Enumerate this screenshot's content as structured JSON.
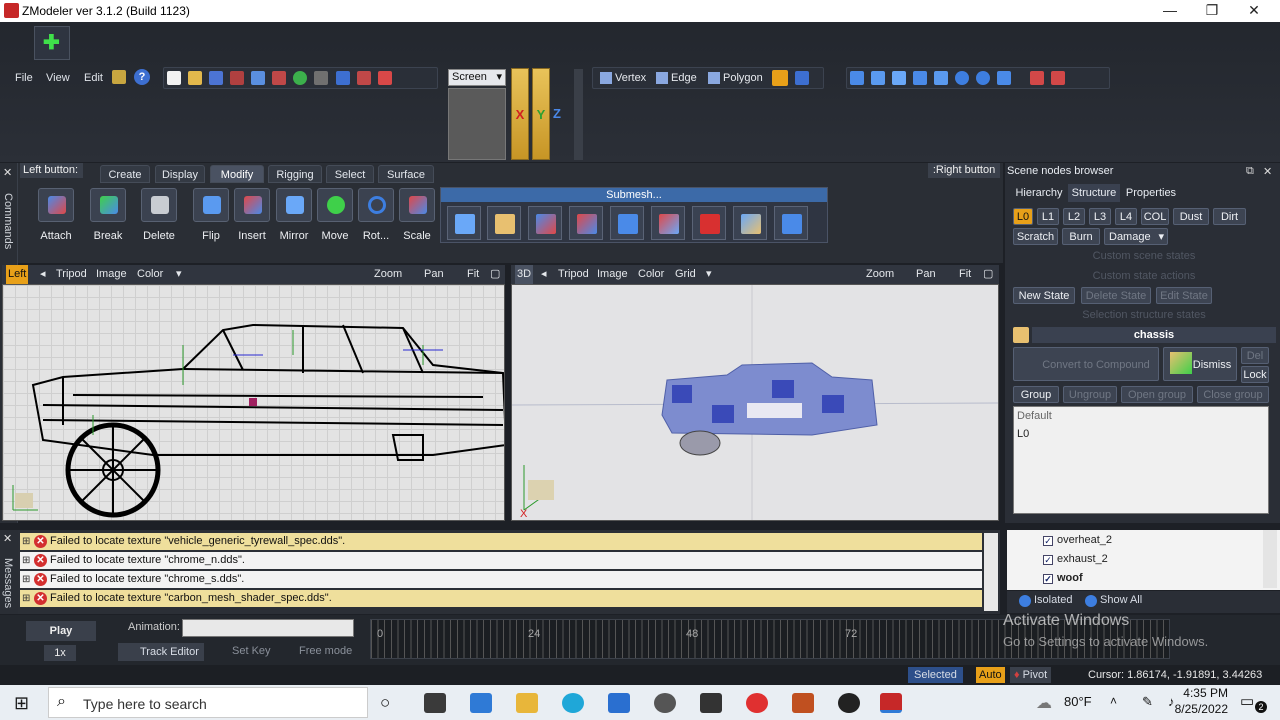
{
  "window": {
    "title": "ZModeler ver 3.1.2 (Build 1123)",
    "min": "—",
    "max": "❐",
    "close": "✕"
  },
  "menu": {
    "file": "File",
    "view": "View",
    "edit": "Edit"
  },
  "coord_space": {
    "selected": "Screen"
  },
  "axes": {
    "x": "X",
    "y": "Y",
    "z": "Z"
  },
  "selection_modes": {
    "vertex": "Vertex",
    "edge": "Edge",
    "polygon": "Polygon"
  },
  "command_panel": {
    "left_button_label": "Left button:",
    "right_button_label": ":Right button",
    "side_label": "Commands",
    "tabs": [
      "Create",
      "Display",
      "Modify",
      "Rigging",
      "Select",
      "Surface"
    ],
    "active_tab": "Modify",
    "tools": [
      "Attach",
      "Break",
      "Delete",
      "Flip",
      "Insert",
      "Mirror",
      "Move",
      "Rot...",
      "Scale"
    ],
    "submesh_label": "Submesh..."
  },
  "viewport_left": {
    "name": "Left",
    "tripod": "Tripod",
    "image": "Image",
    "color": "Color",
    "zoom": "Zoom",
    "pan": "Pan",
    "fit": "Fit"
  },
  "viewport_3d": {
    "name": "3D",
    "tripod": "Tripod",
    "image": "Image",
    "color": "Color",
    "grid": "Grid",
    "zoom": "Zoom",
    "pan": "Pan",
    "fit": "Fit"
  },
  "scene_browser": {
    "title": "Scene nodes browser",
    "tabs": [
      "Hierarchy",
      "Structure",
      "Properties"
    ],
    "active_tab": "Structure",
    "lod_chips": [
      "L0",
      "L1",
      "L2",
      "L3",
      "L4",
      "COL",
      "Dust",
      "Dirt"
    ],
    "state_chips": [
      "Scratch",
      "Burn",
      "Damage"
    ],
    "custom_scene_states": "Custom scene states",
    "custom_state_actions": "Custom state actions",
    "new_state": "New State",
    "delete_state": "Delete State",
    "edit_state": "Edit State",
    "selection_structure_states": "Selection structure states",
    "node_name": "chassis",
    "convert_compound": "Convert to Compound",
    "dismiss": "Dismiss",
    "del": "Del",
    "lock": "Lock",
    "group": "Group",
    "ungroup": "Ungroup",
    "open_group": "Open group",
    "close_group": "Close group",
    "list": [
      "Default",
      "L0"
    ],
    "tree_items": [
      "overheat_2",
      "exhaust_2",
      "woof"
    ],
    "isolated": "Isolated",
    "show_all": "Show All"
  },
  "messages": {
    "side_label": "Messages",
    "rows": [
      "Failed to locate texture \"vehicle_generic_tyrewall_spec.dds\".",
      "Failed to locate texture \"chrome_n.dds\".",
      "Failed to locate texture \"chrome_s.dds\".",
      "Failed to locate texture \"carbon_mesh_shader_spec.dds\"."
    ]
  },
  "animation": {
    "play": "Play",
    "speed": "1x",
    "label": "Animation:",
    "track_editor": "Track Editor",
    "set_key": "Set Key",
    "free_mode": "Free mode",
    "ticks": [
      "0",
      "24",
      "48",
      "72"
    ]
  },
  "status": {
    "selected": "Selected",
    "auto": "Auto",
    "pivot": "Pivot",
    "cursor": "Cursor: 1.86174, -1.91891, 3.44263"
  },
  "watermark": {
    "line1": "Activate Windows",
    "line2": "Go to Settings to activate Windows."
  },
  "taskbar": {
    "search_placeholder": "Type here to search",
    "weather": "80°F",
    "time": "4:35 PM",
    "date": "8/25/2022",
    "notif_count": "2"
  },
  "colors": {
    "accent_orange": "#e8a019",
    "error_red": "#d32f2f",
    "message_highlight": "#efdf9c"
  }
}
